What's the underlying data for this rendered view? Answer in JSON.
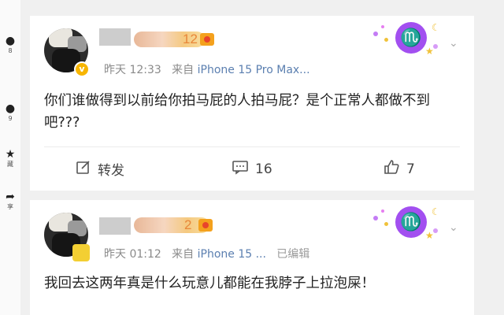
{
  "left_rail": {
    "items": [
      {
        "count": "8"
      },
      {
        "count": "9"
      },
      {
        "label": "藏"
      },
      {
        "label": "享"
      }
    ]
  },
  "posts": [
    {
      "name_suffix": "12",
      "time": "昨天 12:33",
      "source_prefix": "来自",
      "device": "iPhone 15 Pro Max...",
      "text": "你们谁做得到以前给你拍马屁的人拍马屁？是个正常人都做不到吧???",
      "zodiac_glyph": "♏",
      "actions": {
        "share_label": "转发",
        "comment_count": "16",
        "like_count": "7"
      }
    },
    {
      "name_suffix": "2",
      "time": "昨天 01:12",
      "source_prefix": "来自",
      "device": "iPhone 15 ...",
      "edited": "已编辑",
      "text": "我回去这两年真是什么玩意儿都能在我脖子上拉泡屎！",
      "zodiac_glyph": "♏"
    }
  ],
  "colors": {
    "accent_purple": "#a24ff0",
    "meta_blue": "#5b7fb0",
    "vip_gold": "#f7b500"
  }
}
